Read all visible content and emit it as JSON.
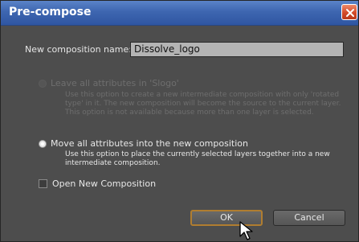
{
  "dialog": {
    "title": "Pre-compose",
    "name_label": "New composition name:",
    "name_value": "Dissolve_logo",
    "options": [
      {
        "title": "Leave all attributes in 'Slogo'",
        "description": "Use this option to create a new intermediate composition with only 'rotated type' in it. The new composition will become the source to the current layer. This option is not available because more than one layer is selected.",
        "selected": false,
        "enabled": false
      },
      {
        "title": "Move all attributes into the new composition",
        "description": "Use this option to place the currently selected layers together into a new intermediate composition.",
        "selected": true,
        "enabled": true
      }
    ],
    "open_new_label": "Open New Composition",
    "open_new_checked": false,
    "ok_label": "OK",
    "cancel_label": "Cancel"
  },
  "colors": {
    "titlebar": "#3e66b0",
    "window_bg": "#4d4d4d",
    "ok_focus_border": "#b07d30",
    "close_button": "#d24a2a"
  },
  "icons": [
    "close-icon",
    "mouse-pointer-icon"
  ]
}
